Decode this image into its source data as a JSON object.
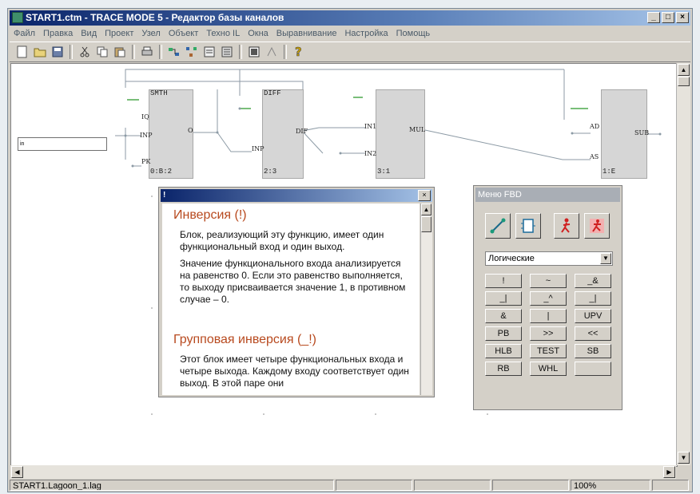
{
  "window": {
    "title": "START1.ctm - TRACE MODE 5 - Редактор базы каналов",
    "min": "_",
    "max": "□",
    "close": "×"
  },
  "menu": [
    "Файл",
    "Правка",
    "Вид",
    "Проект",
    "Узел",
    "Объект",
    "Техно IL",
    "Окна",
    "Выравнивание",
    "Настройка",
    "Помощь"
  ],
  "toolbar": {
    "icons": [
      "new-icon",
      "open-icon",
      "save-icon",
      "cut-icon",
      "copy-icon",
      "paste-icon",
      "print-icon",
      "tool-a-icon",
      "tool-b-icon",
      "tool-c-icon",
      "tool-d-icon",
      "tool-e-icon",
      "tool-f-icon",
      "help-icon"
    ]
  },
  "diagram": {
    "input_text": "in",
    "blocks": [
      {
        "name": "SMTH",
        "id": "0:B:2",
        "inputs": [
          "IQ",
          "INP",
          "PK"
        ],
        "output": "O"
      },
      {
        "name": "DIFF",
        "id": "2:3",
        "inputs": [
          "INP"
        ],
        "output": "DIF"
      },
      {
        "name": "",
        "id": "3:1",
        "inputs": [
          "IN1",
          "IN2"
        ],
        "output": "MUL"
      },
      {
        "name": "",
        "id": "1:E",
        "inputs": [
          "AD",
          "AS"
        ],
        "output": "SUB"
      }
    ]
  },
  "help": {
    "title": "!",
    "close": "×",
    "sections": [
      {
        "heading": "Инверсия (!)",
        "paragraphs": [
          "Блок, реализующий эту функцию, имеет один функциональный вход и один выход.",
          "Значение функционального входа анализируется на равенство 0. Если это равенство выполняется, то выходу присваивается значение 1, в противном случае – 0."
        ]
      },
      {
        "heading": "Групповая инверсия (_!)",
        "paragraphs": [
          "Этот блок имеет четыре функциональных входа и четыре выхода. Каждому входу соответствует один выход. В этой паре они"
        ]
      }
    ]
  },
  "fbd": {
    "title": "Меню FBD",
    "category": "Логические",
    "buttons": [
      "!",
      "~",
      "_&",
      "_|",
      "_^",
      "_|",
      "&",
      "|",
      "UPV",
      "PB",
      ">>",
      "<<",
      "HLB",
      "TEST",
      "SB",
      "RB",
      "WHL",
      ""
    ]
  },
  "status": {
    "file": "START1.Lagoon_1.lag",
    "zoom": "100%"
  }
}
